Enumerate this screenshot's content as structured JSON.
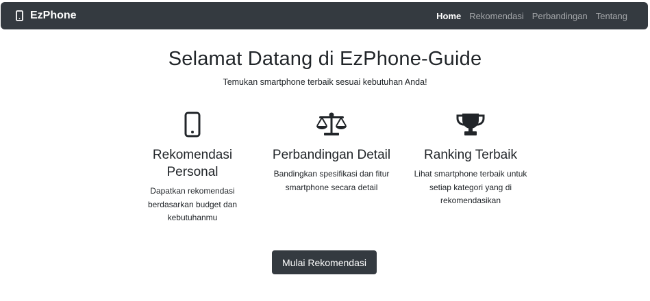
{
  "navbar": {
    "brand_icon": "mobile-phone-icon",
    "brand": "EzPhone",
    "links": [
      {
        "label": "Home",
        "active": true
      },
      {
        "label": "Rekomendasi",
        "active": false
      },
      {
        "label": "Perbandingan",
        "active": false
      },
      {
        "label": "Tentang",
        "active": false
      }
    ]
  },
  "hero": {
    "title": "Selamat Datang di EzPhone-Guide",
    "subtitle": "Temukan smartphone terbaik sesuai kebutuhan Anda!"
  },
  "features": [
    {
      "icon": "mobile-phone-icon",
      "title": "Rekomendasi Personal",
      "description": "Dapatkan rekomendasi berdasarkan budget dan kebutuhanmu"
    },
    {
      "icon": "balance-scale-icon",
      "title": "Perbandingan Detail",
      "description": "Bandingkan spesifikasi dan fitur smartphone secara detail"
    },
    {
      "icon": "trophy-icon",
      "title": "Ranking Terbaik",
      "description": "Lihat smartphone terbaik untuk setiap kategori yang di rekomendasikan"
    }
  ],
  "cta": {
    "label": "Mulai Rekomendasi"
  },
  "colors": {
    "navbar_bg": "#343a40",
    "button_bg": "#343a40",
    "text": "#212529"
  }
}
